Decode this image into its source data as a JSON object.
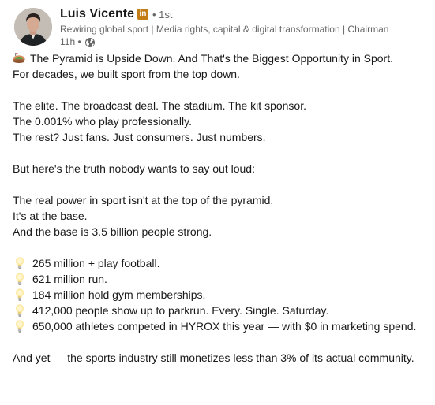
{
  "author": {
    "name": "Luis Vicente",
    "badge": "in",
    "degree": "• 1st",
    "headline": "Rewiring global sport | Media rights, capital & digital transformation | Chairman",
    "time": "11h •",
    "visibility_icon": "globe-icon",
    "badge_color": "#c37d16"
  },
  "post": {
    "title": "The Pyramid is Upside Down. And That's the Biggest Opportunity in Sport.",
    "title_icon": "stadium-emoji",
    "p1": "For decades, we built sport from the top down.",
    "p2": "The elite. The broadcast deal. The stadium. The kit sponsor.",
    "p3": "The 0.001% who play professionally.",
    "p4": "The rest? Just fans. Just consumers. Just numbers.",
    "p5": "But here's the truth nobody wants to say out loud:",
    "p6": "The real power in sport isn't at the top of the pyramid.",
    "p7": "It's at the base.",
    "p8": "And the base is 3.5 billion people strong.",
    "bullet_icon": "light-bulb-icon",
    "bullets": [
      "265 million + play football.",
      "621 million run.",
      "184 million hold gym memberships.",
      "412,000 people show up to parkrun. Every. Single. Saturday.",
      "650,000 athletes competed in HYROX this year — with $0 in marketing spend."
    ],
    "p9": "And yet — the sports industry still monetizes less than 3% of its actual community."
  }
}
